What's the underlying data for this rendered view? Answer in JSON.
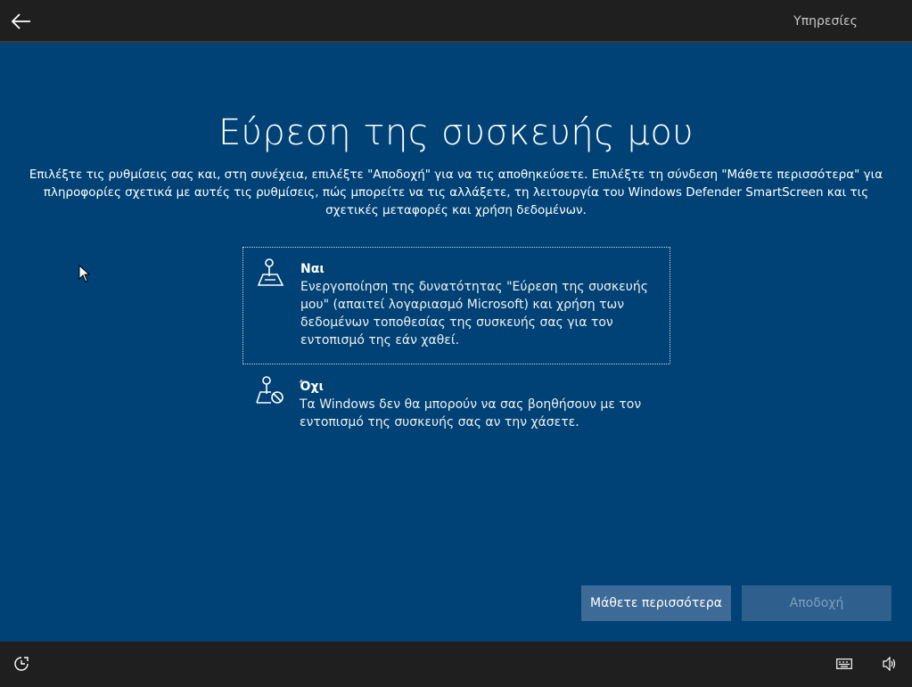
{
  "header": {
    "back_icon": "back-arrow-icon",
    "section_label": "Υπηρεσίες"
  },
  "main": {
    "title": "Εύρεση της συσκευής μου",
    "description": "Επιλέξτε τις ρυθμίσεις σας και, στη συνέχεια, επιλέξτε \"Αποδοχή\" για να τις αποθηκεύσετε. Επιλέξτε τη σύνδεση \"Μάθετε περισσότερα\" για πληροφορίες σχετικά με αυτές τις ρυθμίσεις, πώς μπορείτε να τις αλλάξετε, τη λειτουργία του Windows Defender SmartScreen και τις σχετικές μεταφορές και χρήση δεδομένων.",
    "options": [
      {
        "icon": "map-pin-icon",
        "title": "Ναι",
        "description": "Ενεργοποίηση της δυνατότητας \"Εύρεση της συσκευής μου\" (απαιτεί λογαριασμό Microsoft) και χρήση των δεδομένων τοποθεσίας της συσκευής σας για τον εντοπισμό της εάν χαθεί.",
        "selected": true
      },
      {
        "icon": "map-pin-blocked-icon",
        "title": "Όχι",
        "description": "Τα Windows δεν θα μπορούν να σας βοηθήσουν με τον εντοπισμό της συσκευής σας αν την χάσετε.",
        "selected": false
      }
    ],
    "learn_more_label": "Μάθετε περισσότερα",
    "accept_label": "Αποδοχή"
  },
  "footer": {
    "left_icon": "ease-of-access-icon",
    "right_icons": [
      "keyboard-icon",
      "volume-icon"
    ]
  },
  "colors": {
    "background": "#004275",
    "bar": "#1f1f1f",
    "button_learn": "#3d6a96",
    "button_accept": "#2f5f8c"
  }
}
